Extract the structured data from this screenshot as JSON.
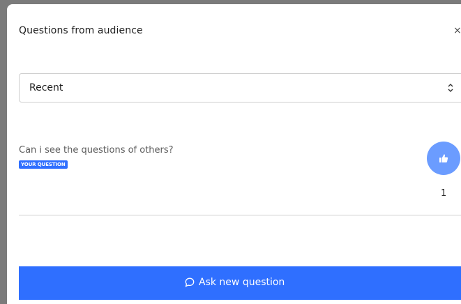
{
  "modal": {
    "title": "Questions from audience",
    "close_glyph": "×"
  },
  "sort_select": {
    "selected": "Recent"
  },
  "questions": [
    {
      "text": "Can i see the questions of others?",
      "badge": "YOUR QUESTION",
      "likes": "1"
    }
  ],
  "ask_button": {
    "label": "Ask new question"
  },
  "colors": {
    "primary": "#2f6fff",
    "like_button": "#6b9cff"
  },
  "icons": [
    "close-icon",
    "chevron-up-down-icon",
    "thumbs-up-icon",
    "chat-bubble-icon"
  ]
}
